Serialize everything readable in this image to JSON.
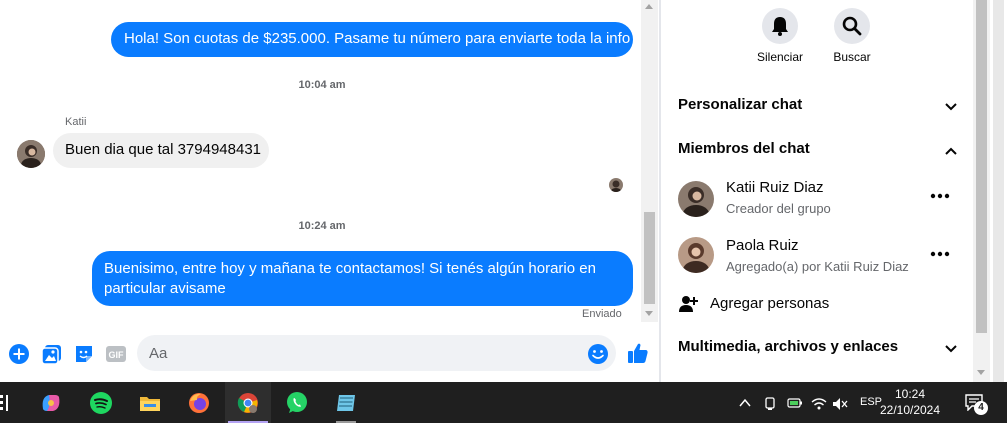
{
  "chat": {
    "messages": {
      "out1": "Hola! Son cuotas de $235.000. Pasame tu número para enviarte toda la info",
      "time1": "10:04 am",
      "in_sender": "Katii",
      "in1": "Buen dia que tal 3794948431",
      "time2": "10:24 am",
      "out2_line1": "Buenisimo, entre hoy y mañana te contactamos! Si tenés algún horario en",
      "out2_line2": "particular avisame",
      "status": "Enviado"
    },
    "composer": {
      "placeholder": "Aa",
      "gif_label": "GIF"
    }
  },
  "panel": {
    "mute_label": "Silenciar",
    "search_label": "Buscar",
    "customize_label": "Personalizar chat",
    "members_label": "Miembros del chat",
    "members": [
      {
        "name": "Katii Ruiz Diaz",
        "role": "Creador del grupo"
      },
      {
        "name": "Paola Ruiz",
        "role": "Agregado(a) por Katii Ruiz Diaz"
      }
    ],
    "add_people_label": "Agregar personas",
    "media_label": "Multimedia, archivos y enlaces"
  },
  "taskbar": {
    "apps": [
      "copilot-icon",
      "spotify-icon",
      "file-explorer-icon",
      "firefox-icon",
      "chrome-icon",
      "whatsapp-icon",
      "notepad-icon"
    ],
    "language": "ESP",
    "time": "10:24",
    "date": "22/10/2024",
    "notification_count": "4"
  },
  "colors": {
    "accent": "#0a7cff",
    "bubble_in": "#f0f0f0",
    "taskbar": "#1f1f1f"
  }
}
